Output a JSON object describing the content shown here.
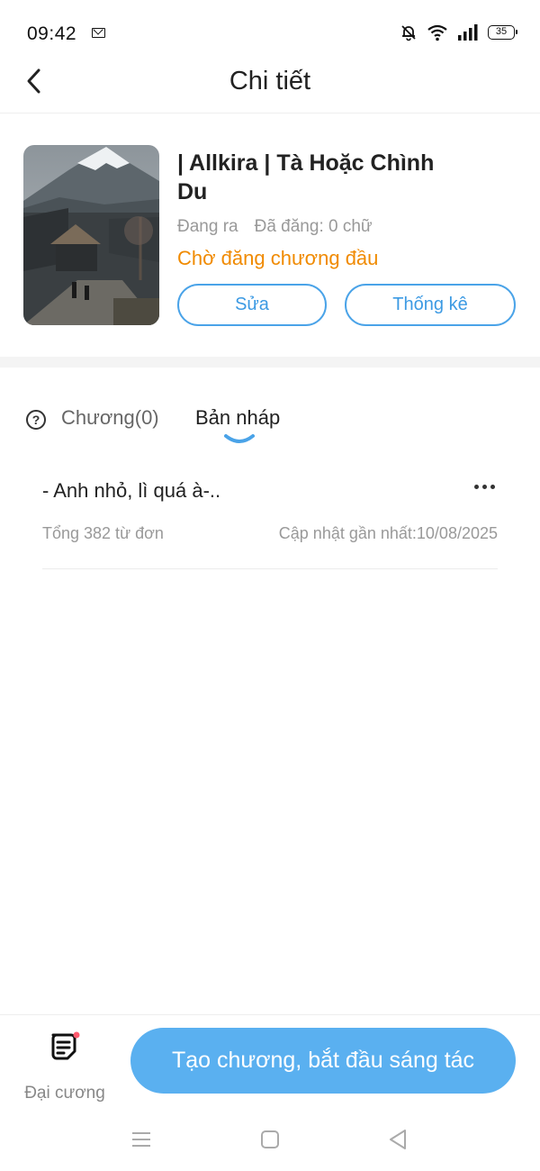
{
  "status_bar": {
    "time": "09:42",
    "battery": "35"
  },
  "header": {
    "title": "Chi tiết"
  },
  "book": {
    "title": "| Allkira | Tà Hoặc Chình Du",
    "publish_state": "Đang ra",
    "word_count": "Đã đăng: 0 chữ",
    "status": "Chờ đăng chương đầu",
    "edit_label": "Sửa",
    "stats_label": "Thống kê"
  },
  "tabs": {
    "chapters": "Chương(0)",
    "drafts": "Bản nháp"
  },
  "drafts": [
    {
      "title": "- Anh nhỏ, lì quá à-..",
      "words": "Tổng 382 từ đơn",
      "updated": "Cập nhật gần nhất:10/08/2025"
    }
  ],
  "bottom": {
    "outline_label": "Đại cương",
    "create_label": "Tạo chương, bắt đầu sáng tác"
  },
  "colors": {
    "accent": "#5ab0f0",
    "outline_blue": "#3c9ae3",
    "status_orange": "#f08a00",
    "notify_dot": "#ff5a6e"
  },
  "icons": [
    "back-arrow-icon",
    "mail-icon",
    "mute-bell-icon",
    "wifi-icon",
    "signal-icon",
    "battery-icon",
    "help-icon",
    "more-icon",
    "outline-doc-icon",
    "menu-icon",
    "home-icon",
    "back-triangle-icon"
  ]
}
